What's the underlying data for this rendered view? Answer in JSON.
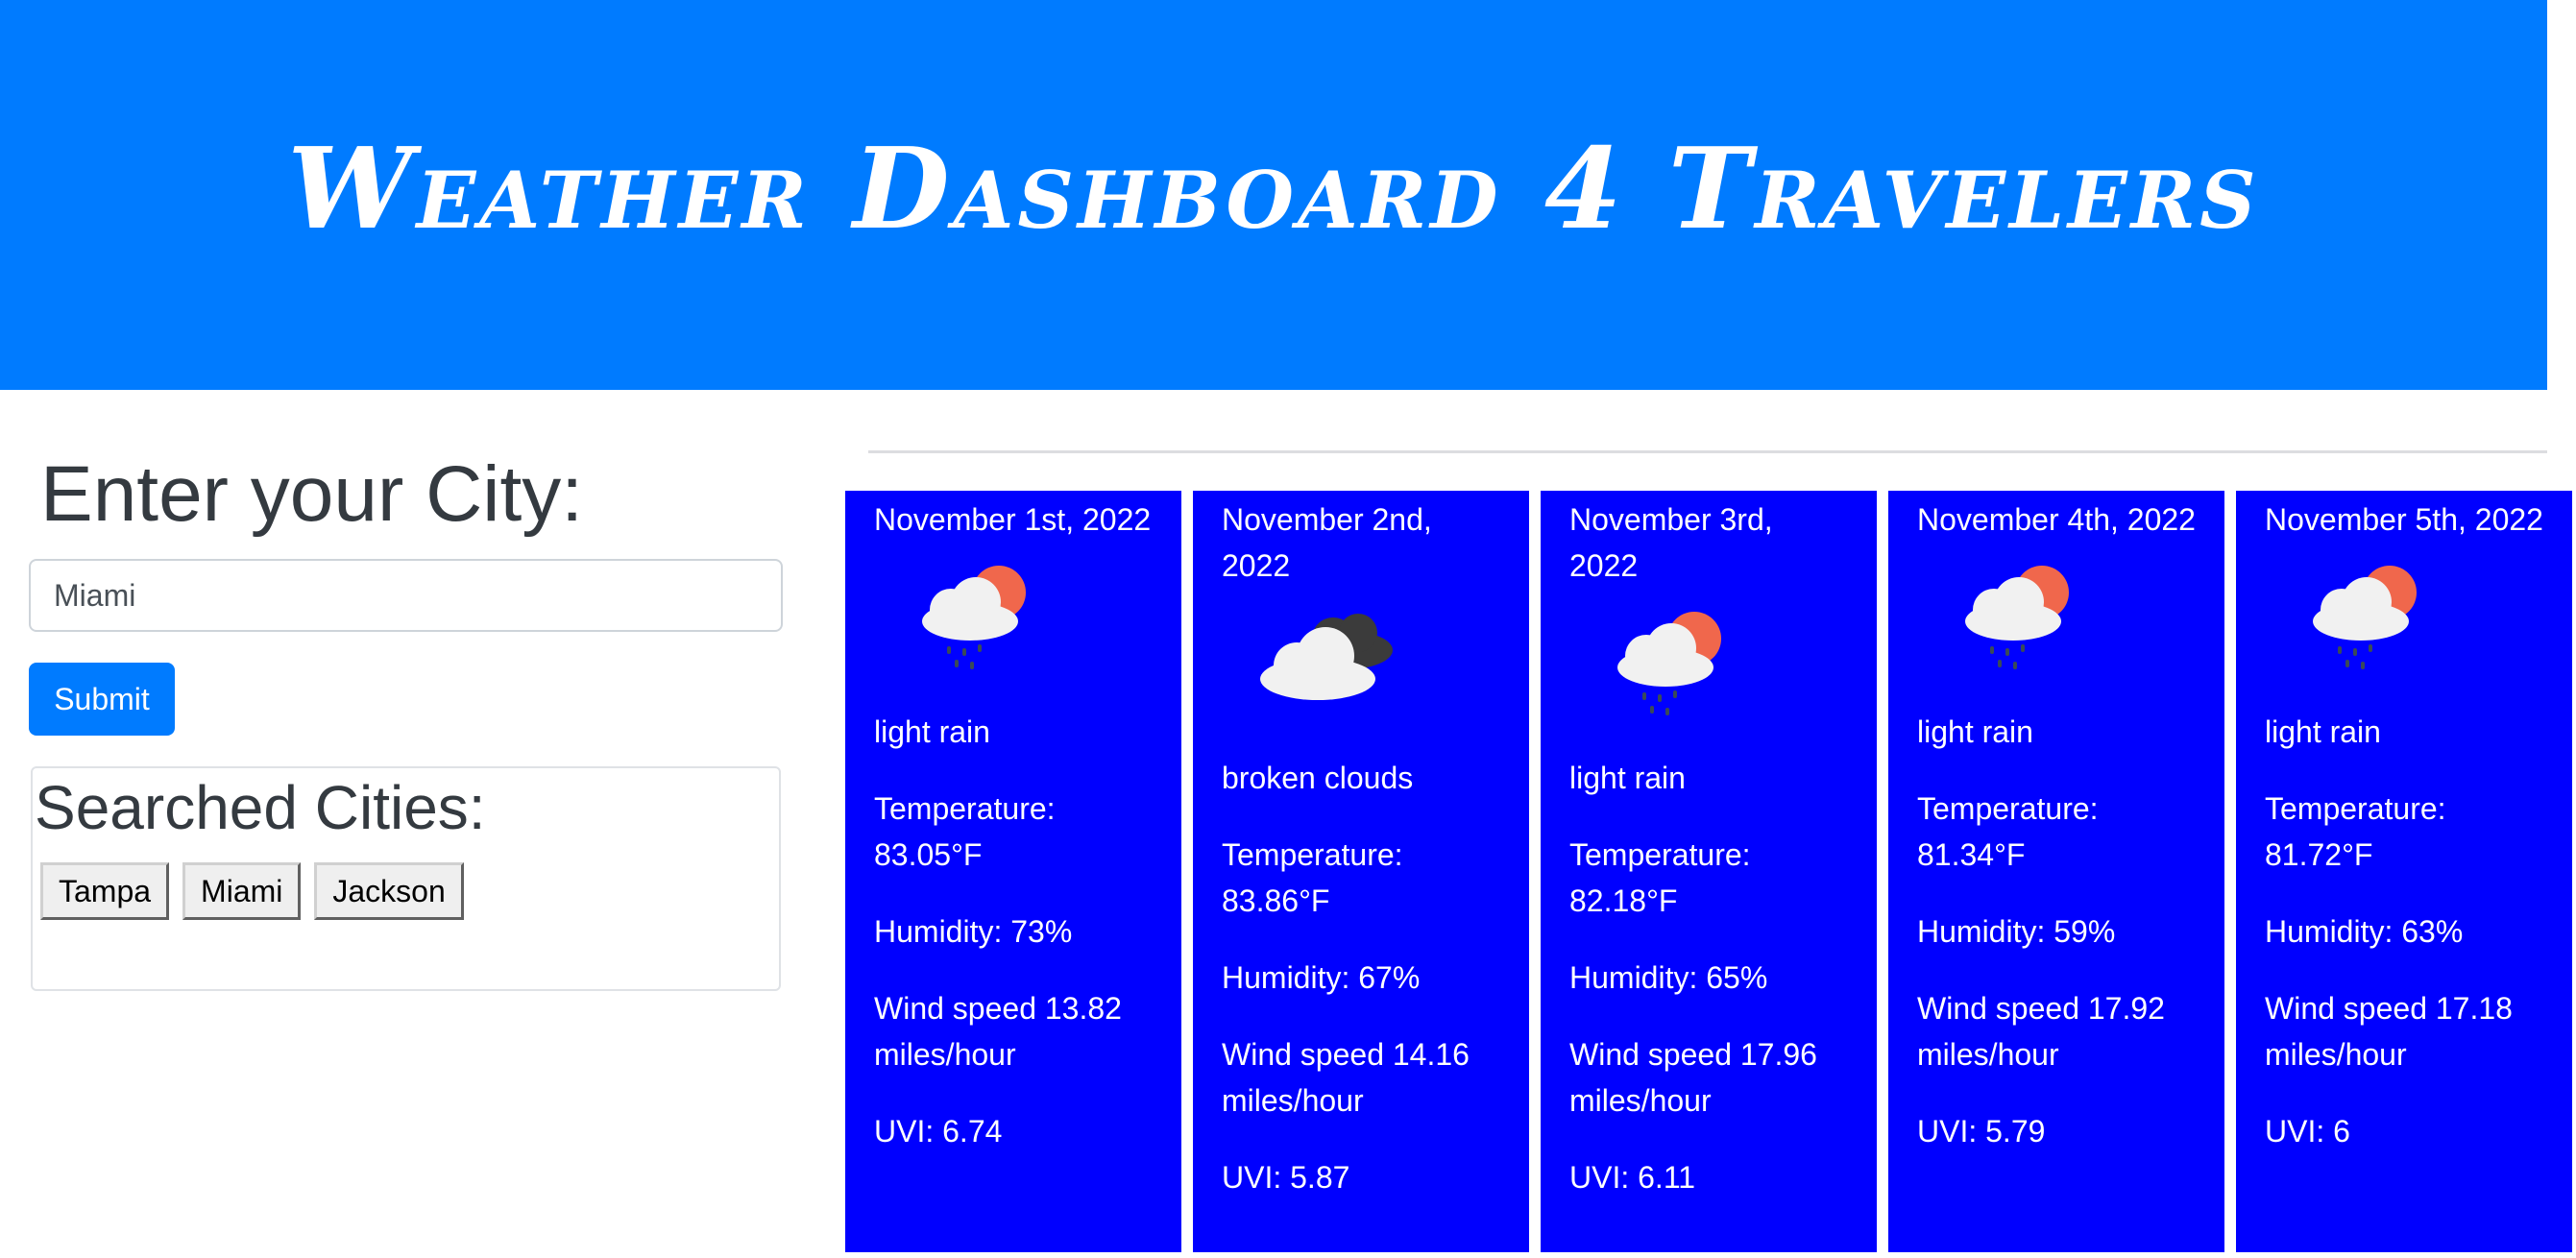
{
  "header": {
    "title": "Weather Dashboard 4 Travelers"
  },
  "search": {
    "heading": "Enter your City:",
    "input_value": "Miami",
    "submit_label": "Submit"
  },
  "history": {
    "heading": "Searched Cities:",
    "cities": [
      "Tampa",
      "Miami",
      "Jackson"
    ]
  },
  "forecast": [
    {
      "date": "November 1st, 2022",
      "icon": "rain-sun-icon",
      "description": "light rain",
      "temperature": "Temperature: 83.05°F",
      "humidity": "Humidity: 73%",
      "wind": "Wind speed 13.82 miles/hour",
      "uvi": "UVI: 6.74"
    },
    {
      "date": "November 2nd, 2022",
      "icon": "broken-clouds-icon",
      "description": "broken clouds",
      "temperature": "Temperature: 83.86°F",
      "humidity": "Humidity: 67%",
      "wind": "Wind speed 14.16 miles/hour",
      "uvi": "UVI: 5.87"
    },
    {
      "date": "November 3rd, 2022",
      "icon": "rain-sun-icon",
      "description": "light rain",
      "temperature": "Temperature: 82.18°F",
      "humidity": "Humidity: 65%",
      "wind": "Wind speed 17.96 miles/hour",
      "uvi": "UVI: 6.11"
    },
    {
      "date": "November 4th, 2022",
      "icon": "rain-sun-icon",
      "description": "light rain",
      "temperature": "Temperature: 81.34°F",
      "humidity": "Humidity: 59%",
      "wind": "Wind speed 17.92 miles/hour",
      "uvi": "UVI: 5.79"
    },
    {
      "date": "November 5th, 2022",
      "icon": "rain-sun-icon",
      "description": "light rain",
      "temperature": "Temperature: 81.72°F",
      "humidity": "Humidity: 63%",
      "wind": "Wind speed 17.18 miles/hour",
      "uvi": "UVI: 6"
    }
  ],
  "colors": {
    "header_bg": "#007bff",
    "card_bg": "#0000ff",
    "button_bg": "#007bff",
    "sun": "#f0674c",
    "cloud": "#f1f1f1",
    "dark_cloud": "#3b3b3b",
    "rain": "#3a4a58"
  }
}
